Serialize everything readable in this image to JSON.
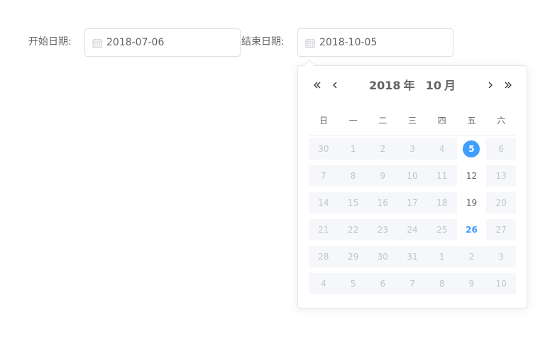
{
  "start": {
    "label": "开始日期:",
    "value": "2018-07-06"
  },
  "end": {
    "label": "结束日期:",
    "value": "2018-10-05"
  },
  "picker": {
    "year": "2018",
    "year_unit": "年",
    "month": "10",
    "month_unit": "月",
    "nav_icons": [
      "double-chevron-left-icon",
      "chevron-left-icon",
      "chevron-right-icon",
      "double-chevron-right-icon"
    ],
    "weekdays": [
      "日",
      "一",
      "二",
      "三",
      "四",
      "五",
      "六"
    ],
    "weeks": [
      [
        "30",
        "1",
        "2",
        "3",
        "4",
        "5",
        "6"
      ],
      [
        "7",
        "8",
        "9",
        "10",
        "11",
        "12",
        "13"
      ],
      [
        "14",
        "15",
        "16",
        "17",
        "18",
        "19",
        "20"
      ],
      [
        "21",
        "22",
        "23",
        "24",
        "25",
        "26",
        "27"
      ],
      [
        "28",
        "29",
        "30",
        "31",
        "1",
        "2",
        "3"
      ],
      [
        "4",
        "5",
        "6",
        "7",
        "8",
        "9",
        "10"
      ]
    ],
    "selected_day": "5",
    "today_day": "26",
    "colors": {
      "accent": "#409eff",
      "disabled_bg": "#f5f7fa",
      "disabled_text": "#c0c4cc",
      "text": "#606266"
    }
  }
}
